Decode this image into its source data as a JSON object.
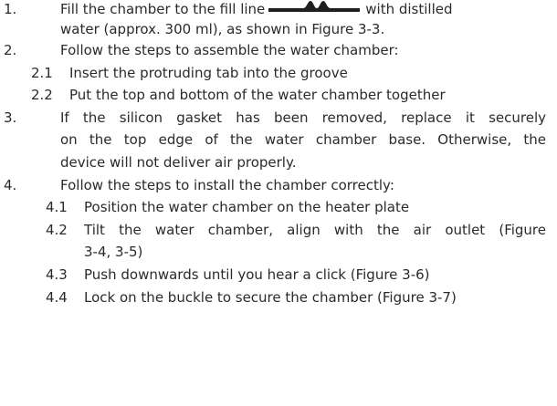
{
  "steps": [
    {
      "num": "1.",
      "lines": [
        {
          "before_icon": "Fill the chamber to the fill line",
          "icon": "fill-line-icon",
          "after_icon": "with distilled"
        },
        {
          "text": "water (approx. 300 ml), as shown in Figure 3-3."
        }
      ]
    },
    {
      "num": "2.",
      "lines": [
        {
          "text": "Follow the steps to assemble the water chamber:"
        }
      ],
      "substeps": [
        {
          "num": "2.1",
          "text": "Insert the protruding tab into the groove"
        },
        {
          "num": "2.2",
          "text": "Put the top and bottom of the water chamber together"
        }
      ]
    },
    {
      "num": "3.",
      "lines": [
        {
          "text": "If the silicon gasket has been removed, replace it securely"
        },
        {
          "text": "on the top edge of the water chamber base. Otherwise, the"
        },
        {
          "text": "device will not deliver air properly."
        }
      ]
    },
    {
      "num": "4.",
      "lines": [
        {
          "text": "Follow the steps to install the chamber correctly:"
        }
      ],
      "substeps": [
        {
          "num": "4.1",
          "lines": [
            "Position the water chamber on the heater plate"
          ]
        },
        {
          "num": "4.2",
          "lines": [
            "Tilt the water chamber, align with the air outlet (Figure",
            "3-4, 3-5)"
          ]
        },
        {
          "num": "4.3",
          "lines": [
            "Push downwards until you hear a click (Figure 3-6)"
          ]
        },
        {
          "num": "4.4",
          "lines": [
            "Lock on the buckle to secure the chamber (Figure 3-7)"
          ]
        }
      ]
    }
  ]
}
